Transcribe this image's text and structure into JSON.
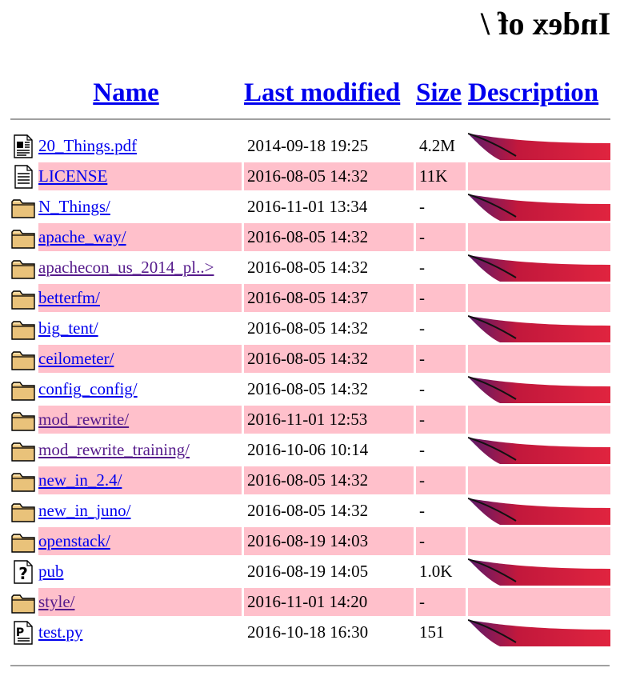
{
  "page": {
    "title": "Index of /"
  },
  "columns": {
    "name": "Name",
    "last_modified": "Last modified",
    "size": "Size",
    "description": "Description"
  },
  "rows": [
    {
      "name": "20_Things.pdf",
      "modified": "2014-09-18 19:25",
      "size": "4.2M",
      "icon": "pdf-file-icon",
      "visited": false
    },
    {
      "name": "LICENSE",
      "modified": "2016-08-05 14:32",
      "size": "11K",
      "icon": "text-file-icon",
      "visited": false
    },
    {
      "name": "N_Things/",
      "modified": "2016-11-01 13:34",
      "size": "-",
      "icon": "folder-icon",
      "visited": false
    },
    {
      "name": "apache_way/",
      "modified": "2016-08-05 14:32",
      "size": "-",
      "icon": "folder-icon",
      "visited": false
    },
    {
      "name": "apachecon_us_2014_pl..>",
      "modified": "2016-08-05 14:32",
      "size": "-",
      "icon": "folder-icon",
      "visited": true
    },
    {
      "name": "betterfm/",
      "modified": "2016-08-05 14:37",
      "size": "-",
      "icon": "folder-icon",
      "visited": false
    },
    {
      "name": "big_tent/",
      "modified": "2016-08-05 14:32",
      "size": "-",
      "icon": "folder-icon",
      "visited": false
    },
    {
      "name": "ceilometer/",
      "modified": "2016-08-05 14:32",
      "size": "-",
      "icon": "folder-icon",
      "visited": false
    },
    {
      "name": "config_config/",
      "modified": "2016-08-05 14:32",
      "size": "-",
      "icon": "folder-icon",
      "visited": false
    },
    {
      "name": "mod_rewrite/",
      "modified": "2016-11-01 12:53",
      "size": "-",
      "icon": "folder-icon",
      "visited": true
    },
    {
      "name": "mod_rewrite_training/",
      "modified": "2016-10-06 10:14",
      "size": "-",
      "icon": "folder-icon",
      "visited": true
    },
    {
      "name": "new_in_2.4/",
      "modified": "2016-08-05 14:32",
      "size": "-",
      "icon": "folder-icon",
      "visited": false
    },
    {
      "name": "new_in_juno/",
      "modified": "2016-08-05 14:32",
      "size": "-",
      "icon": "folder-icon",
      "visited": false
    },
    {
      "name": "openstack/",
      "modified": "2016-08-19 14:03",
      "size": "-",
      "icon": "folder-icon",
      "visited": false
    },
    {
      "name": "pub",
      "modified": "2016-08-19 14:05",
      "size": "1.0K",
      "icon": "unknown-file-icon",
      "visited": false
    },
    {
      "name": "style/",
      "modified": "2016-11-01 14:20",
      "size": "-",
      "icon": "folder-icon",
      "visited": true
    },
    {
      "name": "test.py",
      "modified": "2016-10-18 16:30",
      "size": "151",
      "icon": "script-file-icon",
      "visited": false
    }
  ],
  "colors": {
    "link": "#0000ee",
    "visited": "#551a8b",
    "stripe": "#ffc0cb",
    "rule": "#a0a0a0",
    "feather_red": "#d4153a",
    "feather_purple": "#7a1f7a"
  }
}
